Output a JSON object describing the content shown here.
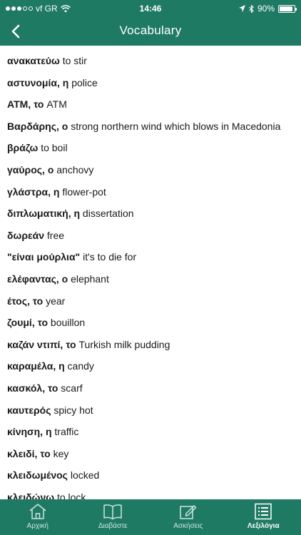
{
  "status_bar": {
    "carrier": "vf GR",
    "time": "14:46",
    "battery_percent": "90%",
    "battery_level": 0.9
  },
  "header": {
    "title": "Vocabulary",
    "back_icon": "chevron-left-icon"
  },
  "vocabulary": [
    {
      "term": "ανακατεύω",
      "meaning": "to stir"
    },
    {
      "term": "αστυνομία, η",
      "meaning": "police"
    },
    {
      "term": "ATM, το",
      "meaning": "ATM"
    },
    {
      "term": "Βαρδάρης, ο",
      "meaning": "strong northern wind which blows in Macedonia"
    },
    {
      "term": "βράζω",
      "meaning": "to boil"
    },
    {
      "term": "γαύρος, ο",
      "meaning": "anchovy"
    },
    {
      "term": "γλάστρα, η",
      "meaning": "flower-pot"
    },
    {
      "term": "διπλωματική, η",
      "meaning": "dissertation"
    },
    {
      "term": "δωρεάν",
      "meaning": "free"
    },
    {
      "term": "\"είναι μούρλια\"",
      "meaning": "it's to die for"
    },
    {
      "term": "ελέφαντας, ο",
      "meaning": "elephant"
    },
    {
      "term": "έτος, το",
      "meaning": "year"
    },
    {
      "term": "ζουμί, το",
      "meaning": "bouillon"
    },
    {
      "term": "καζάν ντιπί, το",
      "meaning": "Turkish milk pudding"
    },
    {
      "term": "καραμέλα, η",
      "meaning": "candy"
    },
    {
      "term": "κασκόλ, το",
      "meaning": "scarf"
    },
    {
      "term": "καυτερός",
      "meaning": "spicy hot"
    },
    {
      "term": "κίνηση, η",
      "meaning": "traffic"
    },
    {
      "term": "κλειδί, το",
      "meaning": "key"
    },
    {
      "term": "κλειδωμένος",
      "meaning": "locked"
    },
    {
      "term": "κλειδώνω",
      "meaning": "to lock"
    }
  ],
  "tabs": [
    {
      "label": "Αρχική",
      "icon": "home-icon",
      "active": false
    },
    {
      "label": "Διαβάστε",
      "icon": "book-icon",
      "active": false
    },
    {
      "label": "Ασκήσεις",
      "icon": "pencil-edit-icon",
      "active": false
    },
    {
      "label": "Λεξιλόγια",
      "icon": "list-icon",
      "active": true
    }
  ],
  "colors": {
    "primary": "#1f7a64",
    "text": "#1a1a1a",
    "tab_inactive": "#cfe6df"
  }
}
